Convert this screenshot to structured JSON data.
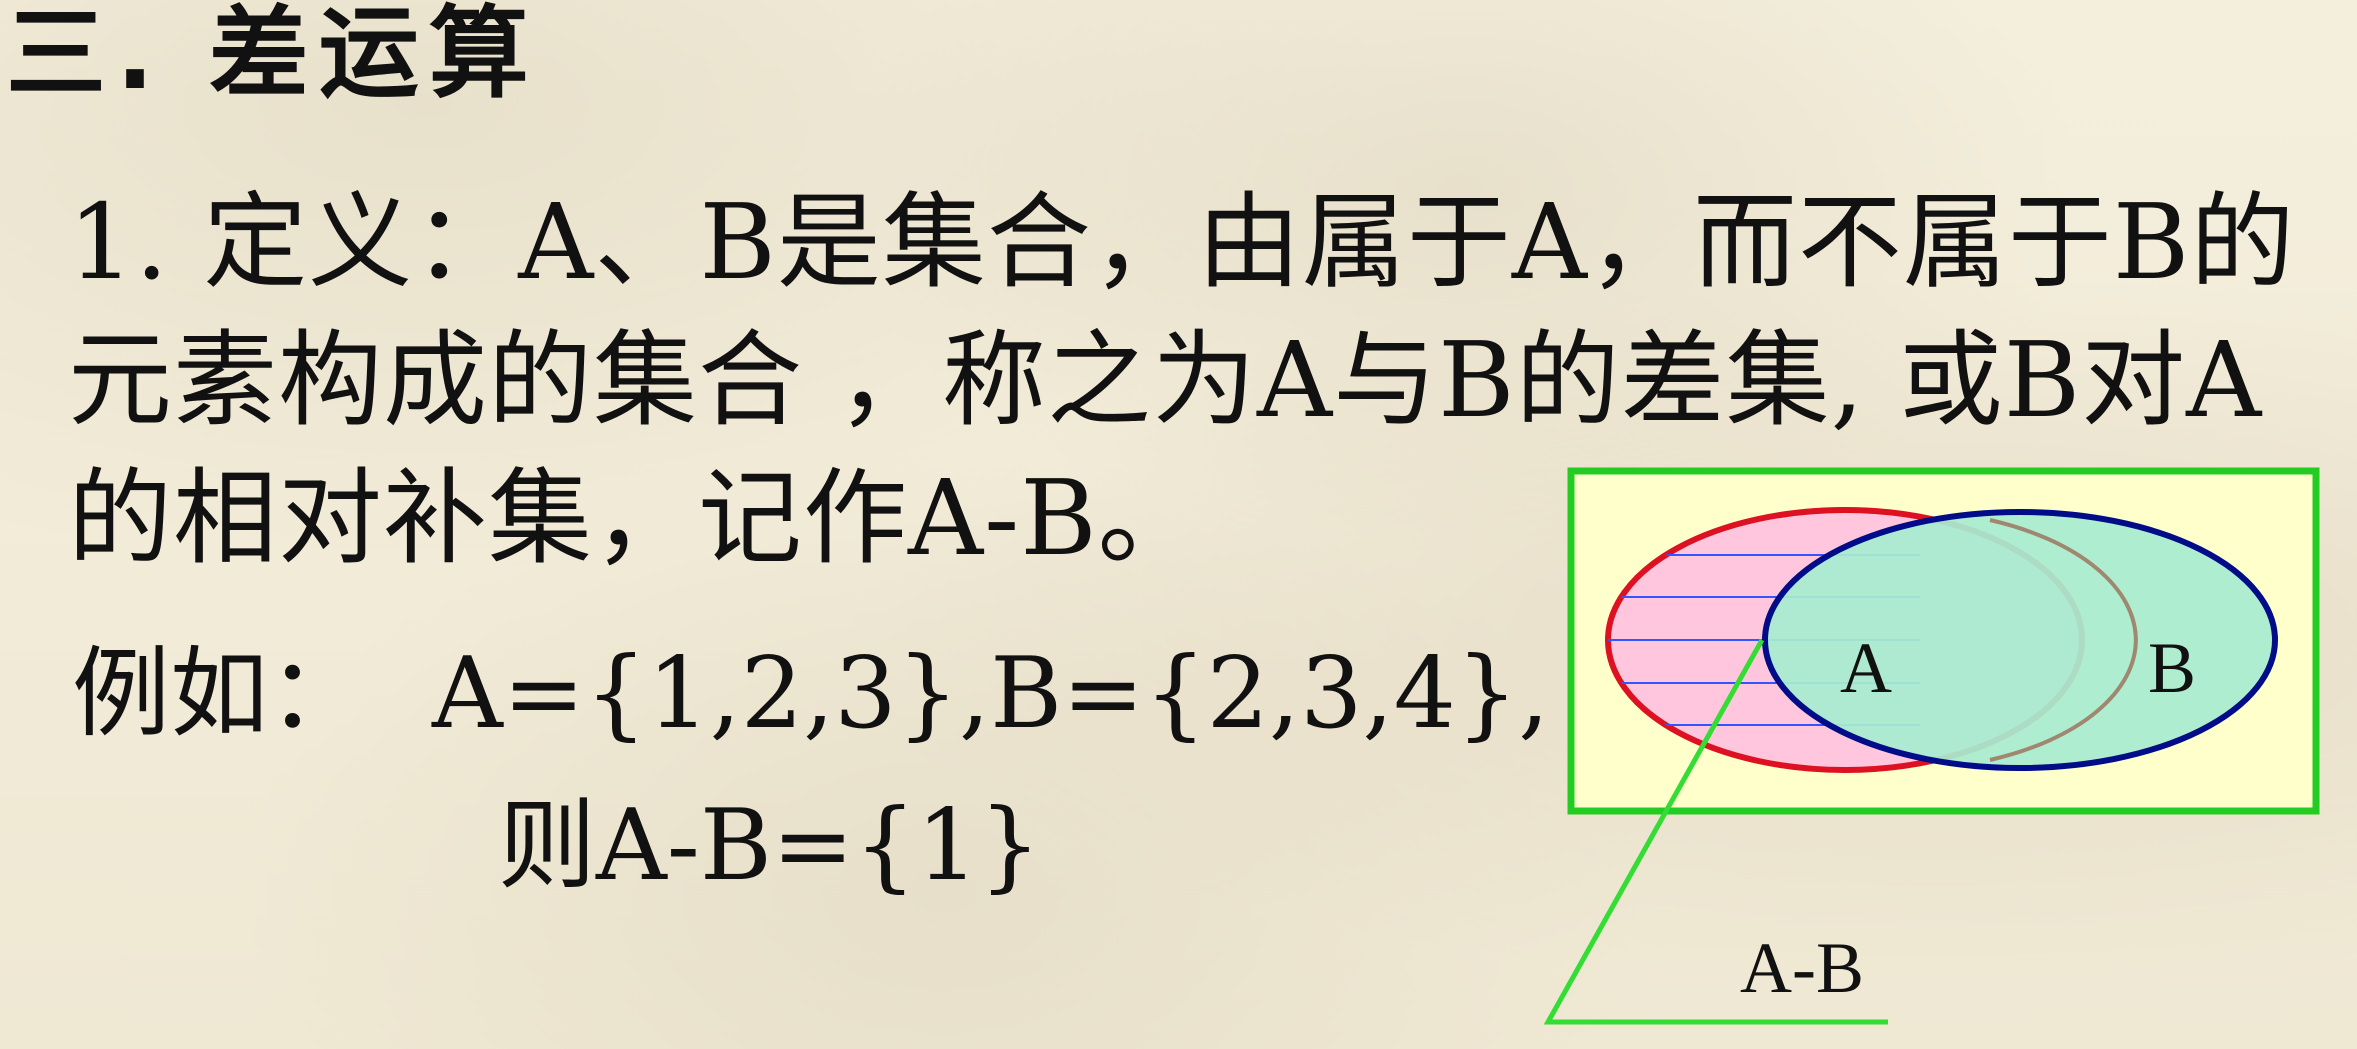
{
  "title": "三. 差运算",
  "definition": {
    "line1": "1. 定义：A、B是集合，由属于A，而不属于B的",
    "line2": "元素构成的集合 ，称之为A与B的差集, 或B对A",
    "line3": "的相对补集，记作A-B。"
  },
  "example": {
    "label": "例如：",
    "sets": "A={1,2,3},B={2,3,4},",
    "result": "则A-B={1}"
  },
  "diagram": {
    "set_a_label": "A",
    "set_b_label": "B",
    "difference_label": "A-B",
    "colors": {
      "universe_fill": "#ffffcc",
      "universe_border": "#22cc22",
      "set_a_fill": "#ffc6dd",
      "set_a_border": "#dd1122",
      "set_b_fill": "#a8ecd0",
      "set_b_border": "#000c88",
      "pointer": "#33dd33",
      "hatch_lines": "#3355ff"
    }
  }
}
